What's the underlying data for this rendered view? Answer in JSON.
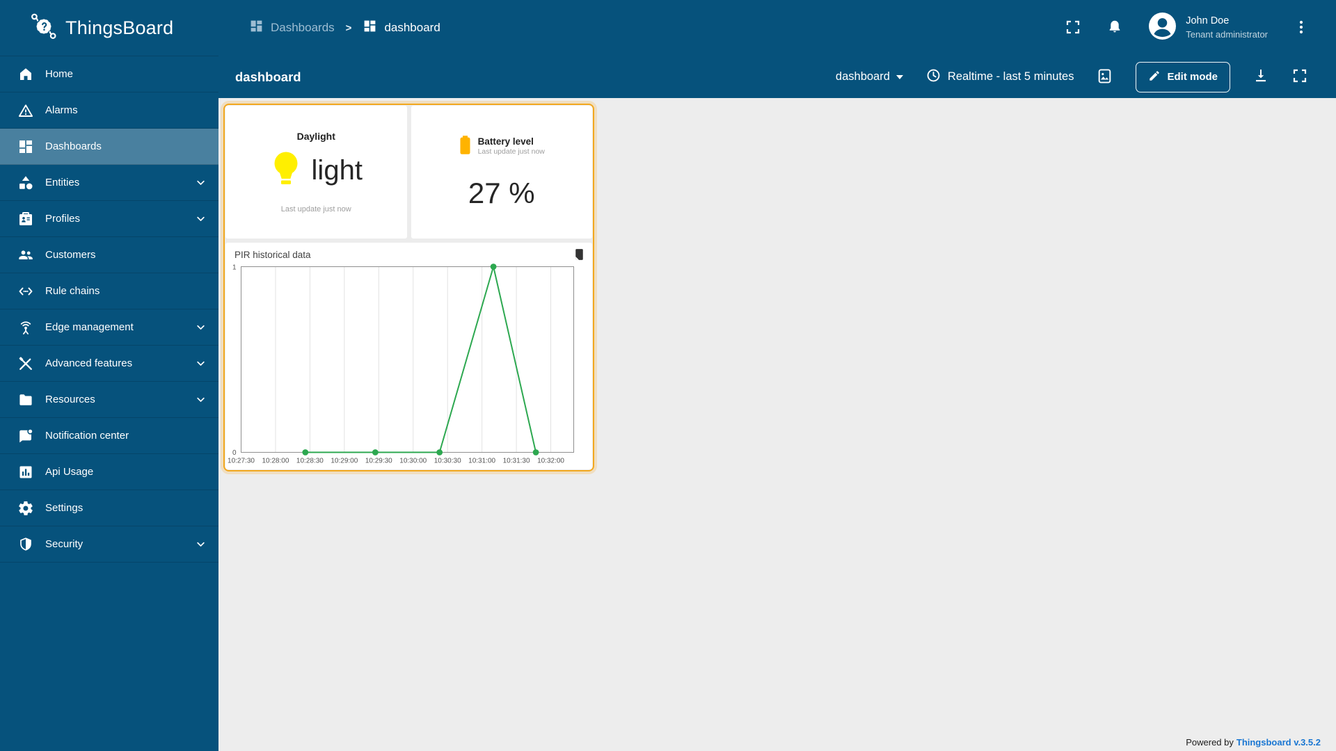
{
  "app": {
    "logo_text": "ThingsBoard",
    "footer_powered": "Powered by",
    "footer_link": "Thingsboard v.3.5.2"
  },
  "colors": {
    "primary": "#06527c",
    "selection_border": "#f2a81e",
    "bulb_yellow": "#ffef00",
    "battery_amber": "#ffb300",
    "line_green": "#2da850",
    "link_blue": "#1976d2",
    "content_bg": "#ededed"
  },
  "breadcrumb": {
    "separator": ">",
    "items": [
      {
        "label": "Dashboards"
      },
      {
        "label": "dashboard"
      }
    ]
  },
  "user": {
    "name": "John Doe",
    "role": "Tenant administrator"
  },
  "sidebar": {
    "items": [
      {
        "label": "Home",
        "icon": "home",
        "selected": false,
        "expandable": false
      },
      {
        "label": "Alarms",
        "icon": "alarms",
        "selected": false,
        "expandable": false
      },
      {
        "label": "Dashboards",
        "icon": "dashboards",
        "selected": true,
        "expandable": false
      },
      {
        "label": "Entities",
        "icon": "entities",
        "selected": false,
        "expandable": true
      },
      {
        "label": "Profiles",
        "icon": "profiles",
        "selected": false,
        "expandable": true
      },
      {
        "label": "Customers",
        "icon": "customers",
        "selected": false,
        "expandable": false
      },
      {
        "label": "Rule chains",
        "icon": "rule-chains",
        "selected": false,
        "expandable": false
      },
      {
        "label": "Edge management",
        "icon": "edge-management",
        "selected": false,
        "expandable": true
      },
      {
        "label": "Advanced features",
        "icon": "advanced-features",
        "selected": false,
        "expandable": true
      },
      {
        "label": "Resources",
        "icon": "resources",
        "selected": false,
        "expandable": true
      },
      {
        "label": "Notification center",
        "icon": "notification-center",
        "selected": false,
        "expandable": false
      },
      {
        "label": "Api Usage",
        "icon": "api-usage",
        "selected": false,
        "expandable": false
      },
      {
        "label": "Settings",
        "icon": "settings",
        "selected": false,
        "expandable": false
      },
      {
        "label": "Security",
        "icon": "security",
        "selected": false,
        "expandable": true
      }
    ]
  },
  "page": {
    "title": "dashboard"
  },
  "toolbar": {
    "dashboard_select": "dashboard",
    "timewindow": "Realtime - last 5 minutes",
    "edit_button": "Edit mode"
  },
  "widgets": {
    "daylight": {
      "title": "Daylight",
      "value": "light",
      "last_update": "Last update just now"
    },
    "battery": {
      "title": "Battery level",
      "subtitle": "Last update just now",
      "value": "27 %"
    }
  },
  "chart_data": {
    "type": "line",
    "title": "PIR historical data",
    "x_tick_labels": [
      "10:27:30",
      "10:28:00",
      "10:28:30",
      "10:29:00",
      "10:29:30",
      "10:30:00",
      "10:30:30",
      "10:31:00",
      "10:31:30",
      "10:32:00"
    ],
    "x_tick_seconds": [
      0,
      30,
      60,
      90,
      120,
      150,
      180,
      210,
      240,
      270
    ],
    "x_range_seconds": [
      0,
      290
    ],
    "y_ticks": [
      "0",
      "1"
    ],
    "y_range": [
      0,
      1
    ],
    "grid": true,
    "legend": "none",
    "series": [
      {
        "name": "PIR",
        "color": "#2da850",
        "points": [
          {
            "t": 56,
            "v": 0
          },
          {
            "t": 117,
            "v": 0
          },
          {
            "t": 173,
            "v": 0
          },
          {
            "t": 220,
            "v": 1
          },
          {
            "t": 257,
            "v": 0
          }
        ]
      }
    ]
  }
}
